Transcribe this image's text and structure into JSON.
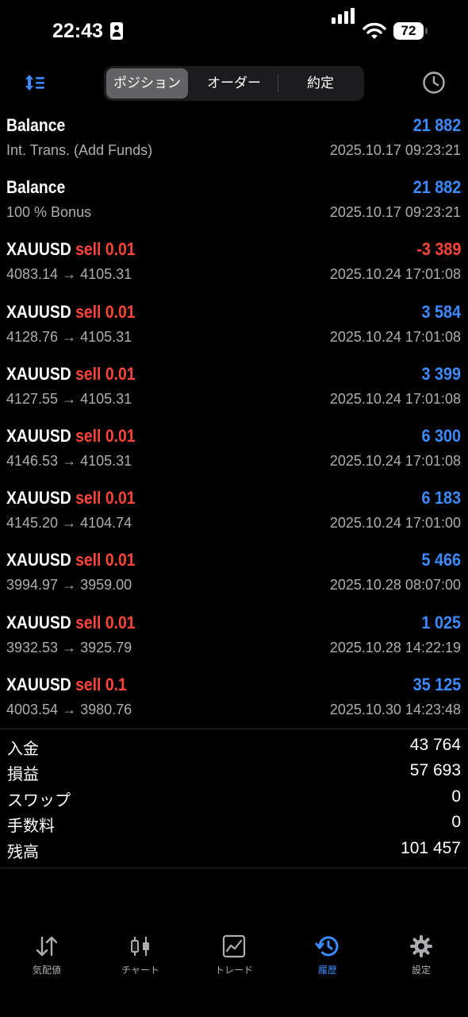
{
  "status_bar": {
    "time": "22:43",
    "battery": "72"
  },
  "toolbar": {
    "segments": [
      {
        "label": "ポジション",
        "active": true
      },
      {
        "label": "オーダー",
        "active": false
      },
      {
        "label": "約定",
        "active": false
      }
    ]
  },
  "rows": [
    {
      "title": "Balance",
      "side": "",
      "amount": "21 882",
      "sub": "Int. Trans. (Add Funds)",
      "time": "2025.10.17 09:23:21"
    },
    {
      "title": "Balance",
      "side": "",
      "amount": "21 882",
      "sub": "100 % Bonus",
      "time": "2025.10.17 09:23:21"
    },
    {
      "title": "XAUUSD",
      "side": "sell 0.01",
      "amount": "-3 389",
      "sub": "4083.14 → 4105.31",
      "time": "2025.10.24 17:01:08"
    },
    {
      "title": "XAUUSD",
      "side": "sell 0.01",
      "amount": "3 584",
      "sub": "4128.76 → 4105.31",
      "time": "2025.10.24 17:01:08"
    },
    {
      "title": "XAUUSD",
      "side": "sell 0.01",
      "amount": "3 399",
      "sub": "4127.55 → 4105.31",
      "time": "2025.10.24 17:01:08"
    },
    {
      "title": "XAUUSD",
      "side": "sell 0.01",
      "amount": "6 300",
      "sub": "4146.53 → 4105.31",
      "time": "2025.10.24 17:01:08"
    },
    {
      "title": "XAUUSD",
      "side": "sell 0.01",
      "amount": "6 183",
      "sub": "4145.20 → 4104.74",
      "time": "2025.10.24 17:01:00"
    },
    {
      "title": "XAUUSD",
      "side": "sell 0.01",
      "amount": "5 466",
      "sub": "3994.97 → 3959.00",
      "time": "2025.10.28 08:07:00"
    },
    {
      "title": "XAUUSD",
      "side": "sell 0.01",
      "amount": "1 025",
      "sub": "3932.53 → 3925.79",
      "time": "2025.10.28 14:22:19"
    },
    {
      "title": "XAUUSD",
      "side": "sell 0.1",
      "amount": "35 125",
      "sub": "4003.54 → 3980.76",
      "time": "2025.10.30 14:23:48"
    }
  ],
  "summary": [
    {
      "label": "入金",
      "value": "43 764"
    },
    {
      "label": "損益",
      "value": "57 693"
    },
    {
      "label": "スワップ",
      "value": "0"
    },
    {
      "label": "手数料",
      "value": "0"
    },
    {
      "label": "残高",
      "value": "101 457"
    }
  ],
  "tabbar": [
    {
      "label": "気配値",
      "icon": "arrows-updown-icon",
      "active": false
    },
    {
      "label": "チャート",
      "icon": "candlestick-icon",
      "active": false
    },
    {
      "label": "トレード",
      "icon": "trade-chart-icon",
      "active": false
    },
    {
      "label": "履歴",
      "icon": "history-icon",
      "active": true
    },
    {
      "label": "設定",
      "icon": "gear-icon",
      "active": false
    }
  ],
  "colors": {
    "accent": "#3d8bff",
    "negative": "#ff453a",
    "secondary_text": "#aeaeb2",
    "segment_bg": "#1c1c1e",
    "segment_active": "#636366"
  }
}
